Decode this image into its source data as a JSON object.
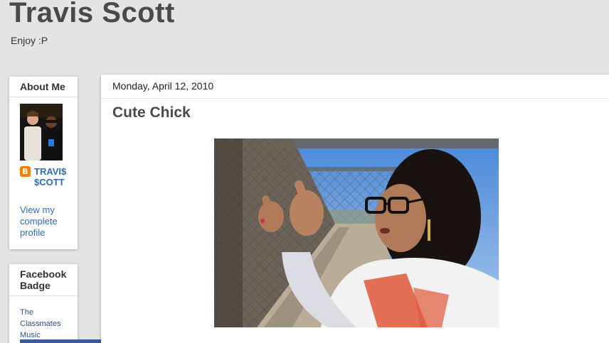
{
  "header": {
    "title": "Travis Scott",
    "description": "Enjoy :P"
  },
  "sidebar": {
    "about": {
      "title": "About Me",
      "name": "TRAVI$ $COTT",
      "profile_link": "View my complete profile",
      "blogger_icon": "blogger-icon"
    },
    "facebook": {
      "title": "Facebook Badge",
      "links": [
        "The",
        "Classmates",
        "Music"
      ]
    }
  },
  "post": {
    "date": "Monday, April 12, 2010",
    "title": "Cute Chick"
  },
  "colors": {
    "link": "#2a6cc0",
    "blogger": "#f57d00",
    "facebook": "#3b5998"
  }
}
